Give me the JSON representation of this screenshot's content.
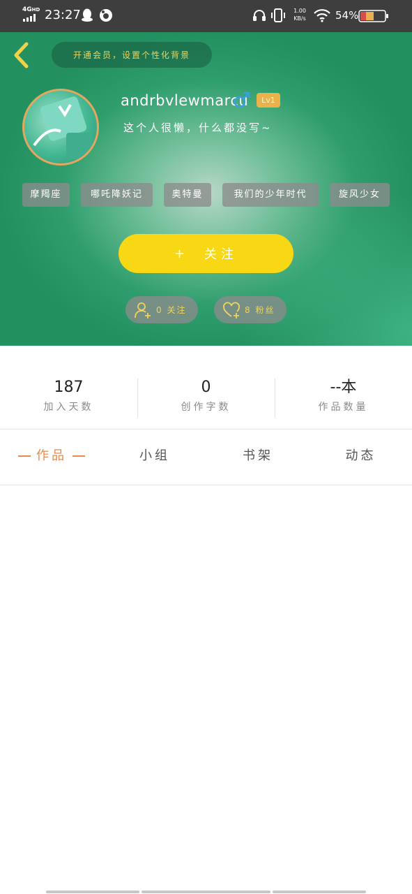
{
  "status_bar": {
    "network": "4G",
    "network_hd": "HD",
    "time": "23:27",
    "speed_value": "1.00",
    "speed_unit": "KB/s",
    "battery_percent": "54%"
  },
  "header": {
    "vip_banner": "开通会员，设置个性化背景",
    "username": "andrbvlewmarcu",
    "gender_symbol": "♂",
    "level": "Lv1",
    "bio": "这个人很懒，什么都没写~",
    "tags": [
      "摩羯座",
      "哪吒降妖记",
      "奥特曼",
      "我们的少年时代",
      "旋风少女"
    ],
    "follow_plus": "+",
    "follow_label": "关注",
    "following_label": "0 关注",
    "fans_label": "8 粉丝"
  },
  "stats": [
    {
      "value": "187",
      "label": "加入天数"
    },
    {
      "value": "0",
      "label": "创作字数"
    },
    {
      "value": "--本",
      "label": "作品数量"
    }
  ],
  "tabs": [
    "作品",
    "小组",
    "书架",
    "动态"
  ],
  "active_tab_index": 0,
  "colors": {
    "accent_orange": "#e88a4c",
    "follow_yellow": "#f8d714",
    "header_green": "#2f9e6c",
    "level_badge": "#e9b24a",
    "gender_blue": "#3aa0e0"
  },
  "icons": {
    "back": "chevron-left-icon",
    "gender": "male-icon",
    "following": "add-user-icon",
    "fans": "heart-plus-icon"
  }
}
